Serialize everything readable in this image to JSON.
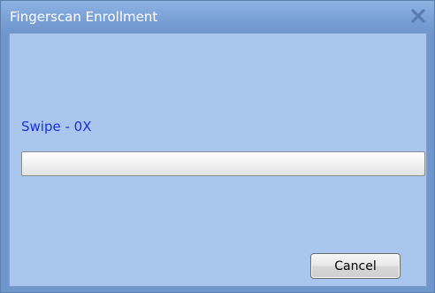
{
  "dialog": {
    "title": "Fingerscan Enrollment",
    "close_icon": "close-x-icon"
  },
  "enrollment": {
    "status_text": "Swipe - 0X",
    "progress_fraction": 0
  },
  "buttons": {
    "cancel_label": "Cancel"
  },
  "colors": {
    "title_bar": "#7ca3d8",
    "client_bg": "#a9c6ee",
    "status_text": "#1c2fd6",
    "close_icon": "#5a7bb0"
  }
}
